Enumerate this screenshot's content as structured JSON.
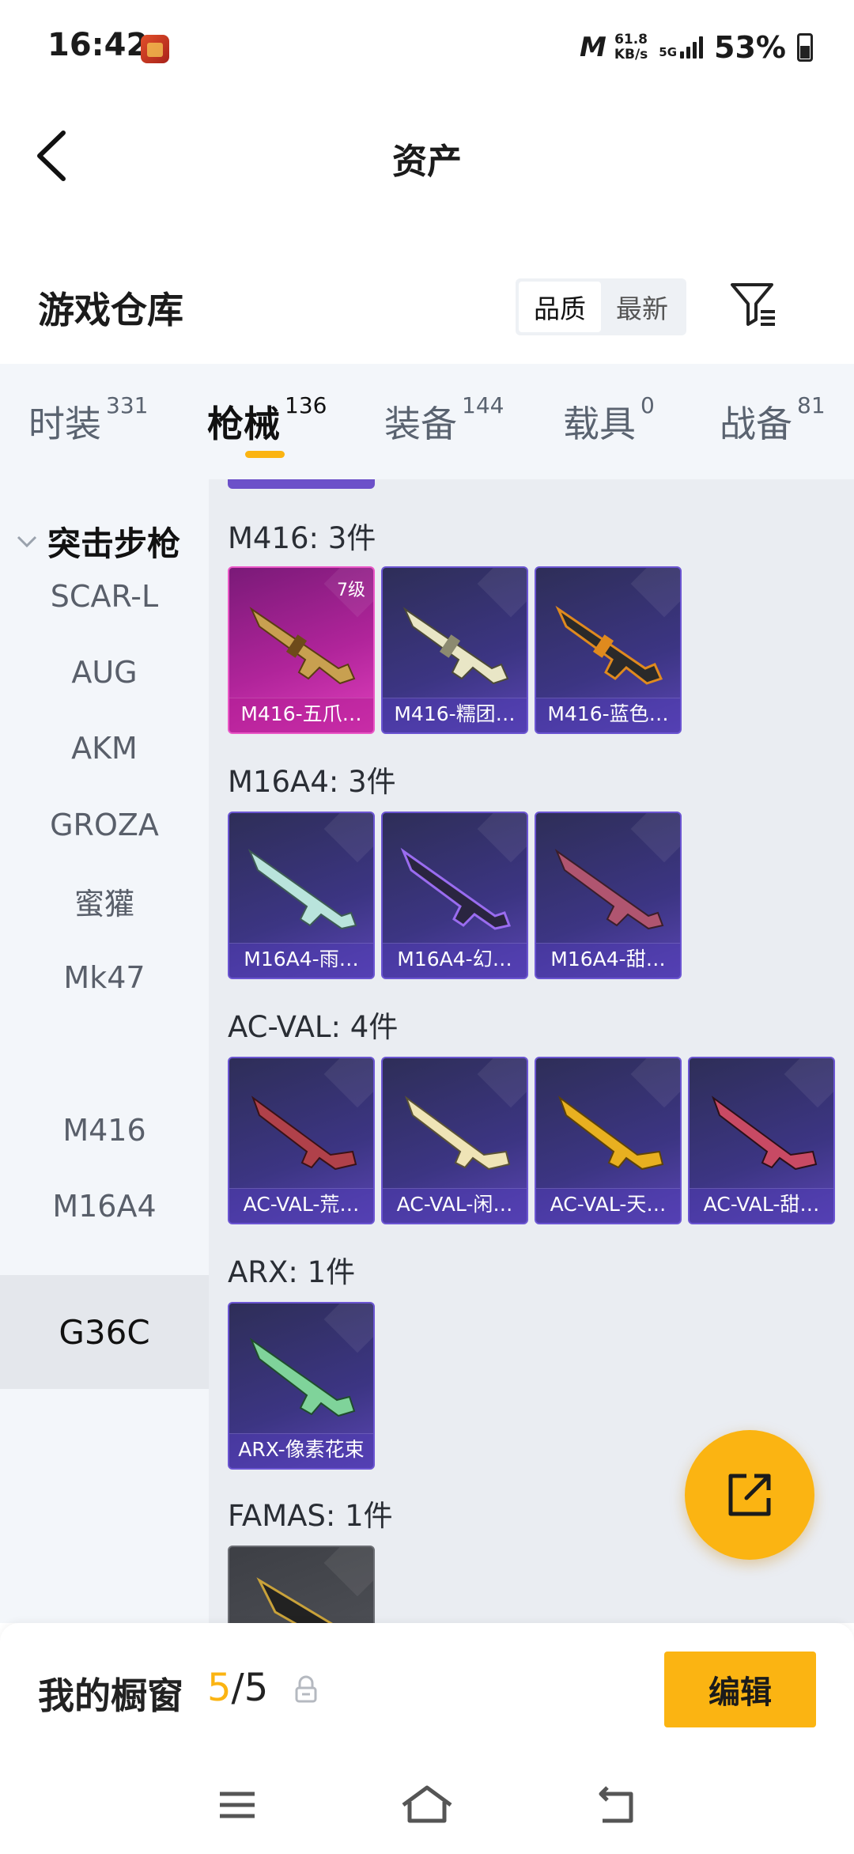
{
  "status_bar": {
    "time": "16:42",
    "network_brand": "M",
    "speed_value": "61.8",
    "speed_unit": "KB/s",
    "network_type": "5G",
    "battery": "53%"
  },
  "header": {
    "title": "资产"
  },
  "warehouse": {
    "title": "游戏仓库",
    "sort": {
      "quality": "品质",
      "newest": "最新"
    }
  },
  "tabs": [
    {
      "label": "时装",
      "count": "331"
    },
    {
      "label": "枪械",
      "count": "136"
    },
    {
      "label": "装备",
      "count": "144"
    },
    {
      "label": "载具",
      "count": "0"
    },
    {
      "label": "战备",
      "count": "81"
    }
  ],
  "sidebar": {
    "category": "突击步枪",
    "items": [
      "SCAR-L",
      "AUG",
      "AKM",
      "GROZA",
      "蜜獾",
      "Mk47",
      "G36C",
      "M416",
      "M16A4"
    ],
    "active": "G36C"
  },
  "groups": [
    {
      "label": "M416: 3件",
      "items": [
        {
          "name": "M416-五爪…",
          "level": "7级",
          "rarity": "legendary"
        },
        {
          "name": "M416-糯团…"
        },
        {
          "name": "M416-蓝色…"
        }
      ]
    },
    {
      "label": "M16A4: 3件",
      "items": [
        {
          "name": "M16A4-雨…"
        },
        {
          "name": "M16A4-幻…"
        },
        {
          "name": "M16A4-甜…"
        }
      ]
    },
    {
      "label": "AC-VAL: 4件",
      "items": [
        {
          "name": "AC-VAL-荒…"
        },
        {
          "name": "AC-VAL-闲…"
        },
        {
          "name": "AC-VAL-天…"
        },
        {
          "name": "AC-VAL-甜…"
        }
      ]
    },
    {
      "label": "ARX: 1件",
      "items": [
        {
          "name": "ARX-像素花束"
        }
      ]
    },
    {
      "label": "FAMAS: 1件",
      "items": []
    }
  ],
  "showcase": {
    "label": "我的橱窗",
    "current": "5",
    "total": "/5",
    "edit_label": "编辑"
  },
  "colors": {
    "accent": "#fbb412",
    "card_purple": "#3c3583",
    "card_magenta": "#b0249a",
    "sidebar_bg": "#f3f6fa",
    "main_bg": "#eaedf2"
  }
}
